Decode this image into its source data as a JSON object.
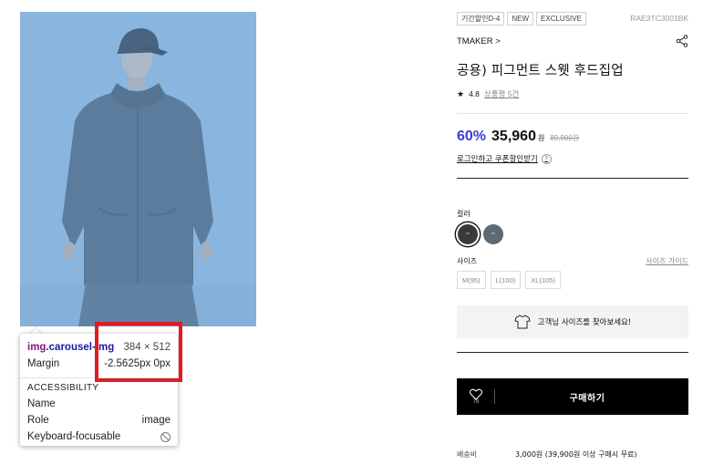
{
  "product_image": {
    "alt": "model wearing pigment sweat hood zip-up",
    "tint_color": "#6fa8dc"
  },
  "devtools_tooltip": {
    "tag": "img",
    "class_name": ".carousel-img",
    "dimensions": "384 × 512",
    "margin_label": "Margin",
    "margin_value": "-2.5625px 0px",
    "accessibility_header": "ACCESSIBILITY",
    "name_label": "Name",
    "name_value": "",
    "role_label": "Role",
    "role_value": "image",
    "focusable_label": "Keyboard-focusable",
    "focusable_icon": "not-allowed-icon"
  },
  "highlight_color": "#e01b24",
  "product": {
    "badges": [
      "기간할인D-4",
      "NEW",
      "EXCLUSIVE"
    ],
    "code": "RAE3TC3001BK",
    "brand": "TMAKER >",
    "title": "공용) 피그먼트 스웻 후드집업",
    "rating": "4.8",
    "review_link": "상품평 5건",
    "discount": "60%",
    "sale_price": "35,960",
    "currency": "원",
    "original_price": "89,900원",
    "coupon_text": "로그인하고 쿠폰할인받기",
    "coupon_help": "?",
    "accent_color": "#3b3bd6",
    "color_label": "컬러",
    "colors": [
      "#3a3a3a",
      "#5c6a76"
    ],
    "size_label": "사이즈",
    "size_guide": "사이즈 가이드",
    "sizes": [
      "M(95)",
      "L(100)",
      "XL(105)"
    ],
    "find_size_text": "고객님 사이즈를 찾아보세요!",
    "wish_count": "78",
    "buy_label": "구매하기",
    "shipping_label": "배송비",
    "shipping_value": "3,000원 (39,900원 이상 구매시 무료)"
  }
}
